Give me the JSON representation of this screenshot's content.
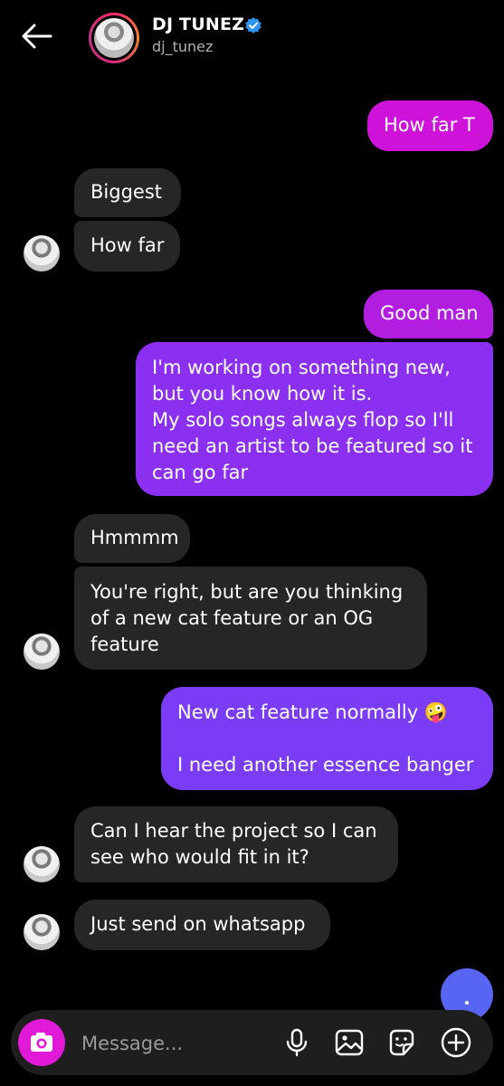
{
  "header": {
    "name": "DJ TUNEZ",
    "handle": "dj_tunez"
  },
  "messages": [
    {
      "text": "How far T",
      "from": "me"
    },
    {
      "text": "Biggest",
      "from": "them"
    },
    {
      "text": "How far",
      "from": "them"
    },
    {
      "text": "Good man",
      "from": "me"
    },
    {
      "lines": [
        "I'm working on something new,",
        "but you know how it is.",
        "My solo songs always flop so I'll",
        "need an artist to be featured so it",
        "can go far"
      ],
      "from": "me"
    },
    {
      "text": "Hmmmm",
      "from": "them"
    },
    {
      "lines": [
        "You're right, but are you thinking",
        "of a new cat feature or an OG",
        "feature"
      ],
      "from": "them"
    },
    {
      "lines": [
        "New cat feature normally 🤪",
        "",
        "I need another essence banger"
      ],
      "from": "me"
    },
    {
      "lines": [
        "Can I hear the project so I can",
        "see who would fit in it?"
      ],
      "from": "them"
    },
    {
      "text": "Just send on whatsapp",
      "from": "them"
    }
  ],
  "composer": {
    "placeholder": "Message..."
  },
  "icons": [
    "back-arrow-icon",
    "verified-badge-icon",
    "camera-icon",
    "microphone-icon",
    "image-icon",
    "sticker-icon",
    "add-icon"
  ]
}
